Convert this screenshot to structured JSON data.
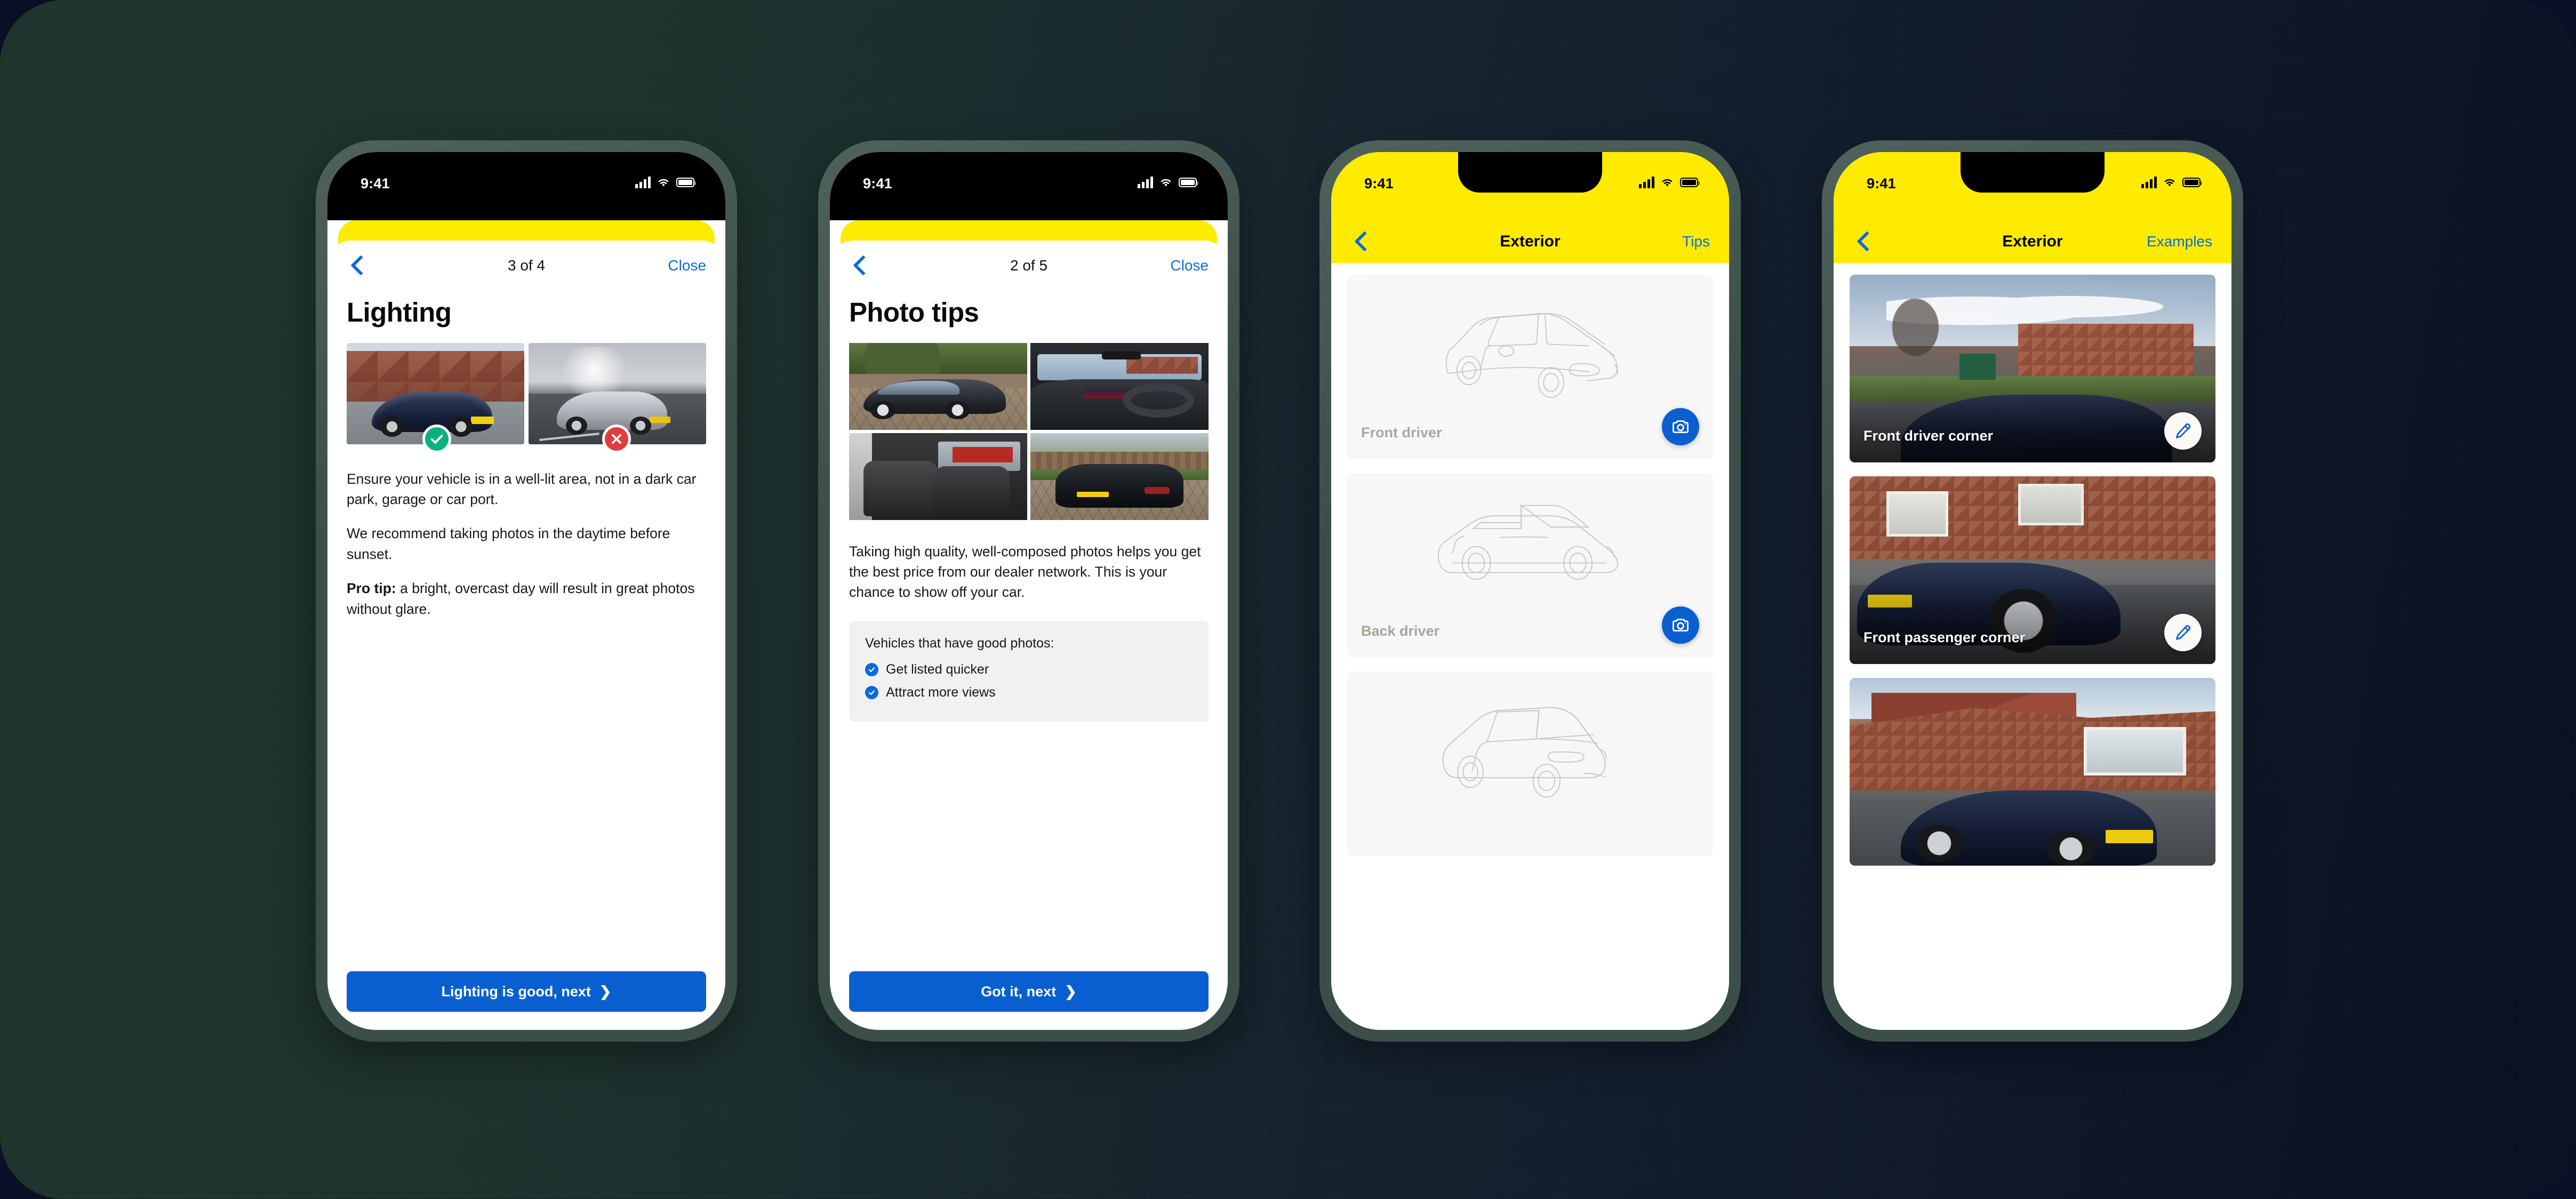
{
  "colors": {
    "brand_yellow": "#FFEB00",
    "accent_blue": "#0a6bdb",
    "cta_blue": "#0a5fd0",
    "success_green": "#0bb07b",
    "error_red": "#e23b3b",
    "backdrop_green": "#22372f",
    "backdrop_navy": "#0c1124",
    "device_frame": "#3b4f48"
  },
  "status_bar": {
    "time": "9:41",
    "icons": [
      "cellular-signal-icon",
      "wifi-icon",
      "battery-icon"
    ]
  },
  "phone1": {
    "nav": {
      "back_icon": "chevron-left-icon",
      "counter": "3 of 4",
      "close_label": "Close"
    },
    "title": "Lighting",
    "images": [
      {
        "name": "navy-mercedes-outside-brick-houses",
        "badge": "check-icon",
        "badge_state": "good"
      },
      {
        "name": "silver-bmw-at-dusk-low-light",
        "badge": "cross-icon",
        "badge_state": "bad"
      }
    ],
    "paragraphs": [
      "Ensure your vehicle is in a well-lit area, not in a dark car park, garage or car port.",
      "We recommend taking photos in the daytime before sunset."
    ],
    "pro_tip_label": "Pro tip:",
    "pro_tip_text": " a bright, overcast day will result in great photos without glare.",
    "cta_label": "Lighting is good, next",
    "cta_arrow": "❯"
  },
  "phone2": {
    "nav": {
      "back_icon": "chevron-left-icon",
      "counter": "2 of 5",
      "close_label": "Close"
    },
    "title": "Photo tips",
    "images": [
      {
        "name": "black-tesla-model-x-on-block-paving"
      },
      {
        "name": "bmw-interior-dashboard-steering-wheel"
      },
      {
        "name": "black-leather-rear-seats-interior"
      },
      {
        "name": "black-vw-tiguan-rear-three-quarter"
      }
    ],
    "paragraph": "Taking high quality, well-composed photos helps you get the best price from our dealer network. This is your chance to show off your car.",
    "card": {
      "heading": "Vehicles that have good photos:",
      "items": [
        "Get listed quicker",
        "Attract more views"
      ],
      "bullet_icon": "check-circle-icon"
    },
    "cta_label": "Got it, next",
    "cta_arrow": "❯"
  },
  "phone3": {
    "nav": {
      "back_icon": "chevron-left-icon",
      "title": "Exterior",
      "action_label": "Tips"
    },
    "capture_slots": [
      {
        "label": "Front driver",
        "outline": "car-front-three-quarter-outline",
        "button_icon": "camera-icon"
      },
      {
        "label": "Back driver",
        "outline": "car-side-outline",
        "button_icon": "camera-icon"
      },
      {
        "label": "",
        "outline": "car-rear-three-quarter-outline",
        "button_icon": "camera-icon"
      }
    ]
  },
  "phone4": {
    "nav": {
      "back_icon": "chevron-left-icon",
      "title": "Exterior",
      "action_label": "Examples"
    },
    "photo_slots": [
      {
        "label": "Front driver corner",
        "image": "navy-mercedes-front-driver-corner-house",
        "button_icon": "pencil-icon"
      },
      {
        "label": "Front passenger corner",
        "image": "navy-mercedes-front-passenger-corner-wheel",
        "button_icon": "pencil-icon"
      },
      {
        "label": "",
        "image": "navy-mercedes-rear-driver-side-driveway",
        "button_icon": "pencil-icon"
      }
    ]
  }
}
